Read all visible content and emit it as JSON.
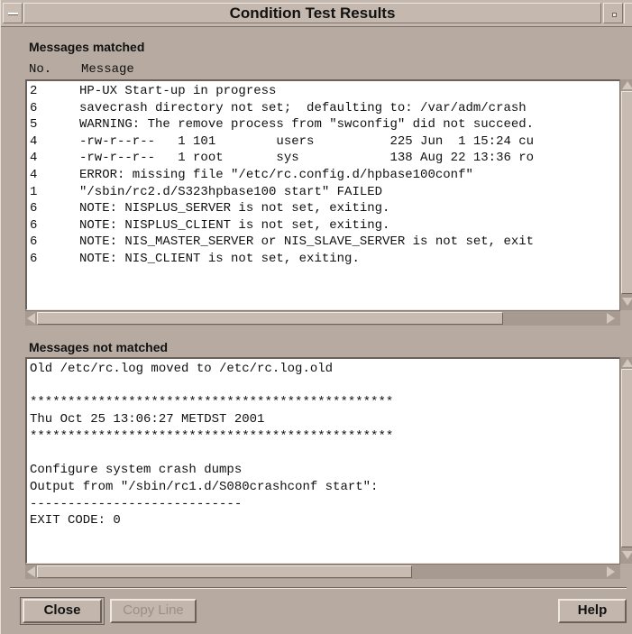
{
  "window": {
    "title": "Condition Test Results"
  },
  "matched": {
    "label": "Messages matched",
    "col_no": "No.",
    "col_message": "Message",
    "rows": [
      {
        "no": "2",
        "message": "HP-UX Start-up in progress"
      },
      {
        "no": "6",
        "message": "savecrash directory not set;  defaulting to: /var/adm/crash"
      },
      {
        "no": "5",
        "message": "WARNING: The remove process from \"swconfig\" did not succeed."
      },
      {
        "no": "4",
        "message": "-rw-r--r--   1 101        users          225 Jun  1 15:24 cu"
      },
      {
        "no": "4",
        "message": "-rw-r--r--   1 root       sys            138 Aug 22 13:36 ro"
      },
      {
        "no": "4",
        "message": "ERROR: missing file \"/etc/rc.config.d/hpbase100conf\""
      },
      {
        "no": "1",
        "message": "\"/sbin/rc2.d/S323hpbase100 start\" FAILED"
      },
      {
        "no": "6",
        "message": "NOTE: NISPLUS_SERVER is not set, exiting."
      },
      {
        "no": "6",
        "message": "NOTE: NISPLUS_CLIENT is not set, exiting."
      },
      {
        "no": "6",
        "message": "NOTE: NIS_MASTER_SERVER or NIS_SLAVE_SERVER is not set, exit"
      },
      {
        "no": "6",
        "message": "NOTE: NIS_CLIENT is not set, exiting."
      }
    ]
  },
  "not_matched": {
    "label": "Messages not matched",
    "lines": [
      "Old /etc/rc.log moved to /etc/rc.log.old",
      "",
      "************************************************",
      "Thu Oct 25 13:06:27 METDST 2001",
      "************************************************",
      "",
      "Configure system crash dumps",
      "Output from \"/sbin/rc1.d/S080crashconf start\":",
      "----------------------------",
      "EXIT CODE: 0"
    ]
  },
  "buttons": {
    "close": "Close",
    "copy_line": "Copy Line",
    "help": "Help"
  },
  "scroll": {
    "matched_horizontal_fraction": 0.82,
    "not_matched_horizontal_fraction": 0.66
  }
}
